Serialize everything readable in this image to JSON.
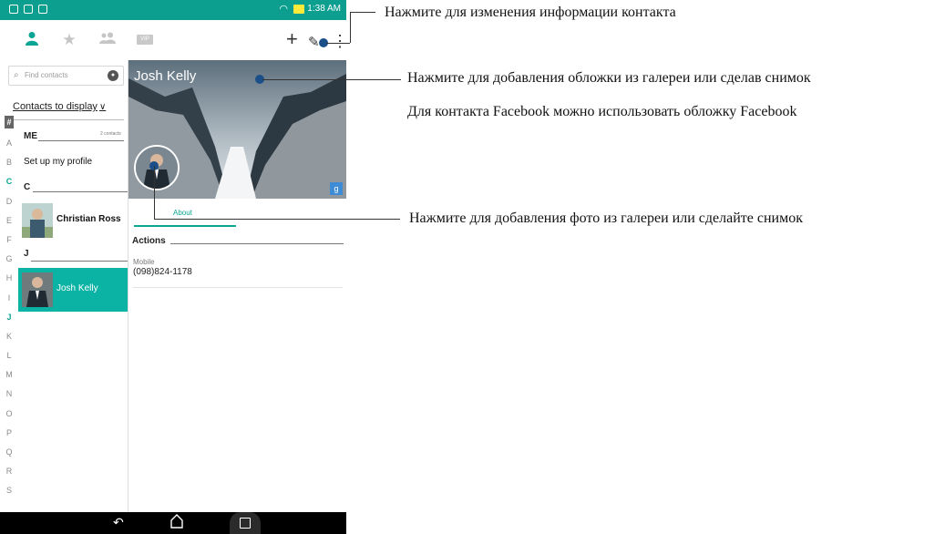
{
  "status": {
    "time": "1:38 AM"
  },
  "toolbar": {
    "tabs": [
      {
        "icon": "person-icon",
        "active": true
      },
      {
        "icon": "star-icon",
        "active": false
      },
      {
        "icon": "group-icon",
        "active": false
      }
    ],
    "vip_label": "VIP",
    "add_glyph": "+",
    "edit_glyph": "✎",
    "more_glyph": "⋮"
  },
  "search": {
    "placeholder": "Find contacts"
  },
  "contacts_to_display": "Contacts to display",
  "alphabet": [
    "#",
    "A",
    "B",
    "C",
    "D",
    "E",
    "F",
    "G",
    "H",
    "I",
    "J",
    "K",
    "L",
    "M",
    "N",
    "O",
    "P",
    "Q",
    "R",
    "S"
  ],
  "me_section": {
    "header": "ME",
    "count": "2 contacts",
    "profile_label": "Set up my profile"
  },
  "c_section": {
    "header": "C",
    "contact": "Christian Ross"
  },
  "j_section": {
    "header": "J",
    "contact": "Josh Kelly"
  },
  "detail": {
    "name": "Josh Kelly",
    "tab_about": "About",
    "actions_header": "Actions",
    "mobile_label": "Mobile",
    "mobile_value": "(098)824-1178"
  },
  "annotations": {
    "edit": "Нажмите для изменения информации контакта",
    "cover_line1": "Нажмите для добавления обложки из галереи или сделав снимок",
    "cover_line2": "Для контакта Facebook можно использовать обложку Facebook",
    "photo": "Нажмите для добавления фото из галереи или сделайте снимок"
  },
  "colors": {
    "accent": "#0aa594",
    "status_bar": "#0c9e8e",
    "selected_row": "#0ab3a3",
    "callout_dot": "#1b4f8a"
  }
}
